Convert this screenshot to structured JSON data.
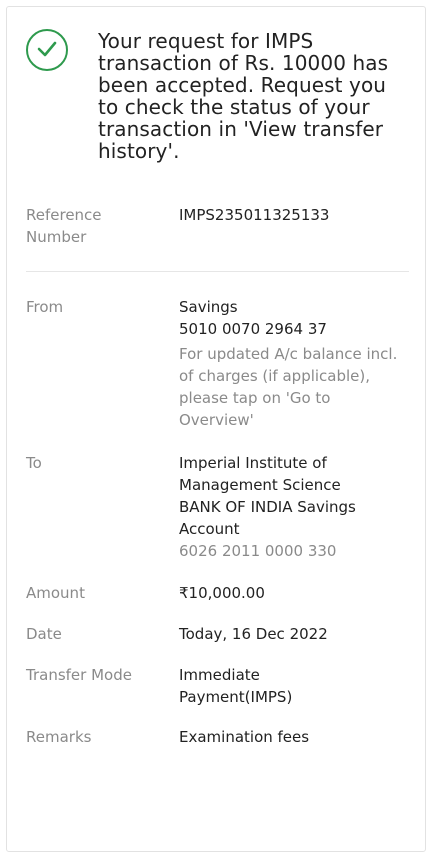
{
  "status": {
    "icon": "check-circle-icon",
    "accent_color": "#2e9a4d",
    "message": "Your request for IMPS transaction of Rs. 10000 has been accepted. Request you to check the status of your transaction in 'View transfer history'."
  },
  "details": {
    "reference": {
      "label": "Reference Number",
      "value": "IMPS235011325133"
    },
    "from": {
      "label": "From",
      "account_type": "Savings",
      "account_number": "5010 0070 2964 37",
      "note": "For updated A/c balance incl. of charges (if applicable), please tap on 'Go to Overview'"
    },
    "to": {
      "label": "To",
      "name": "Imperial Institute of Management Science",
      "bank": "BANK OF INDIA Savings Account",
      "account_number": "6026 2011 0000 330"
    },
    "amount": {
      "label": "Amount",
      "value": "₹10,000.00"
    },
    "date": {
      "label": "Date",
      "value": "Today, 16 Dec 2022"
    },
    "transfer_mode": {
      "label": "Transfer Mode",
      "value": "Immediate Payment(IMPS)"
    },
    "remarks": {
      "label": "Remarks",
      "value": "Examination fees"
    }
  }
}
